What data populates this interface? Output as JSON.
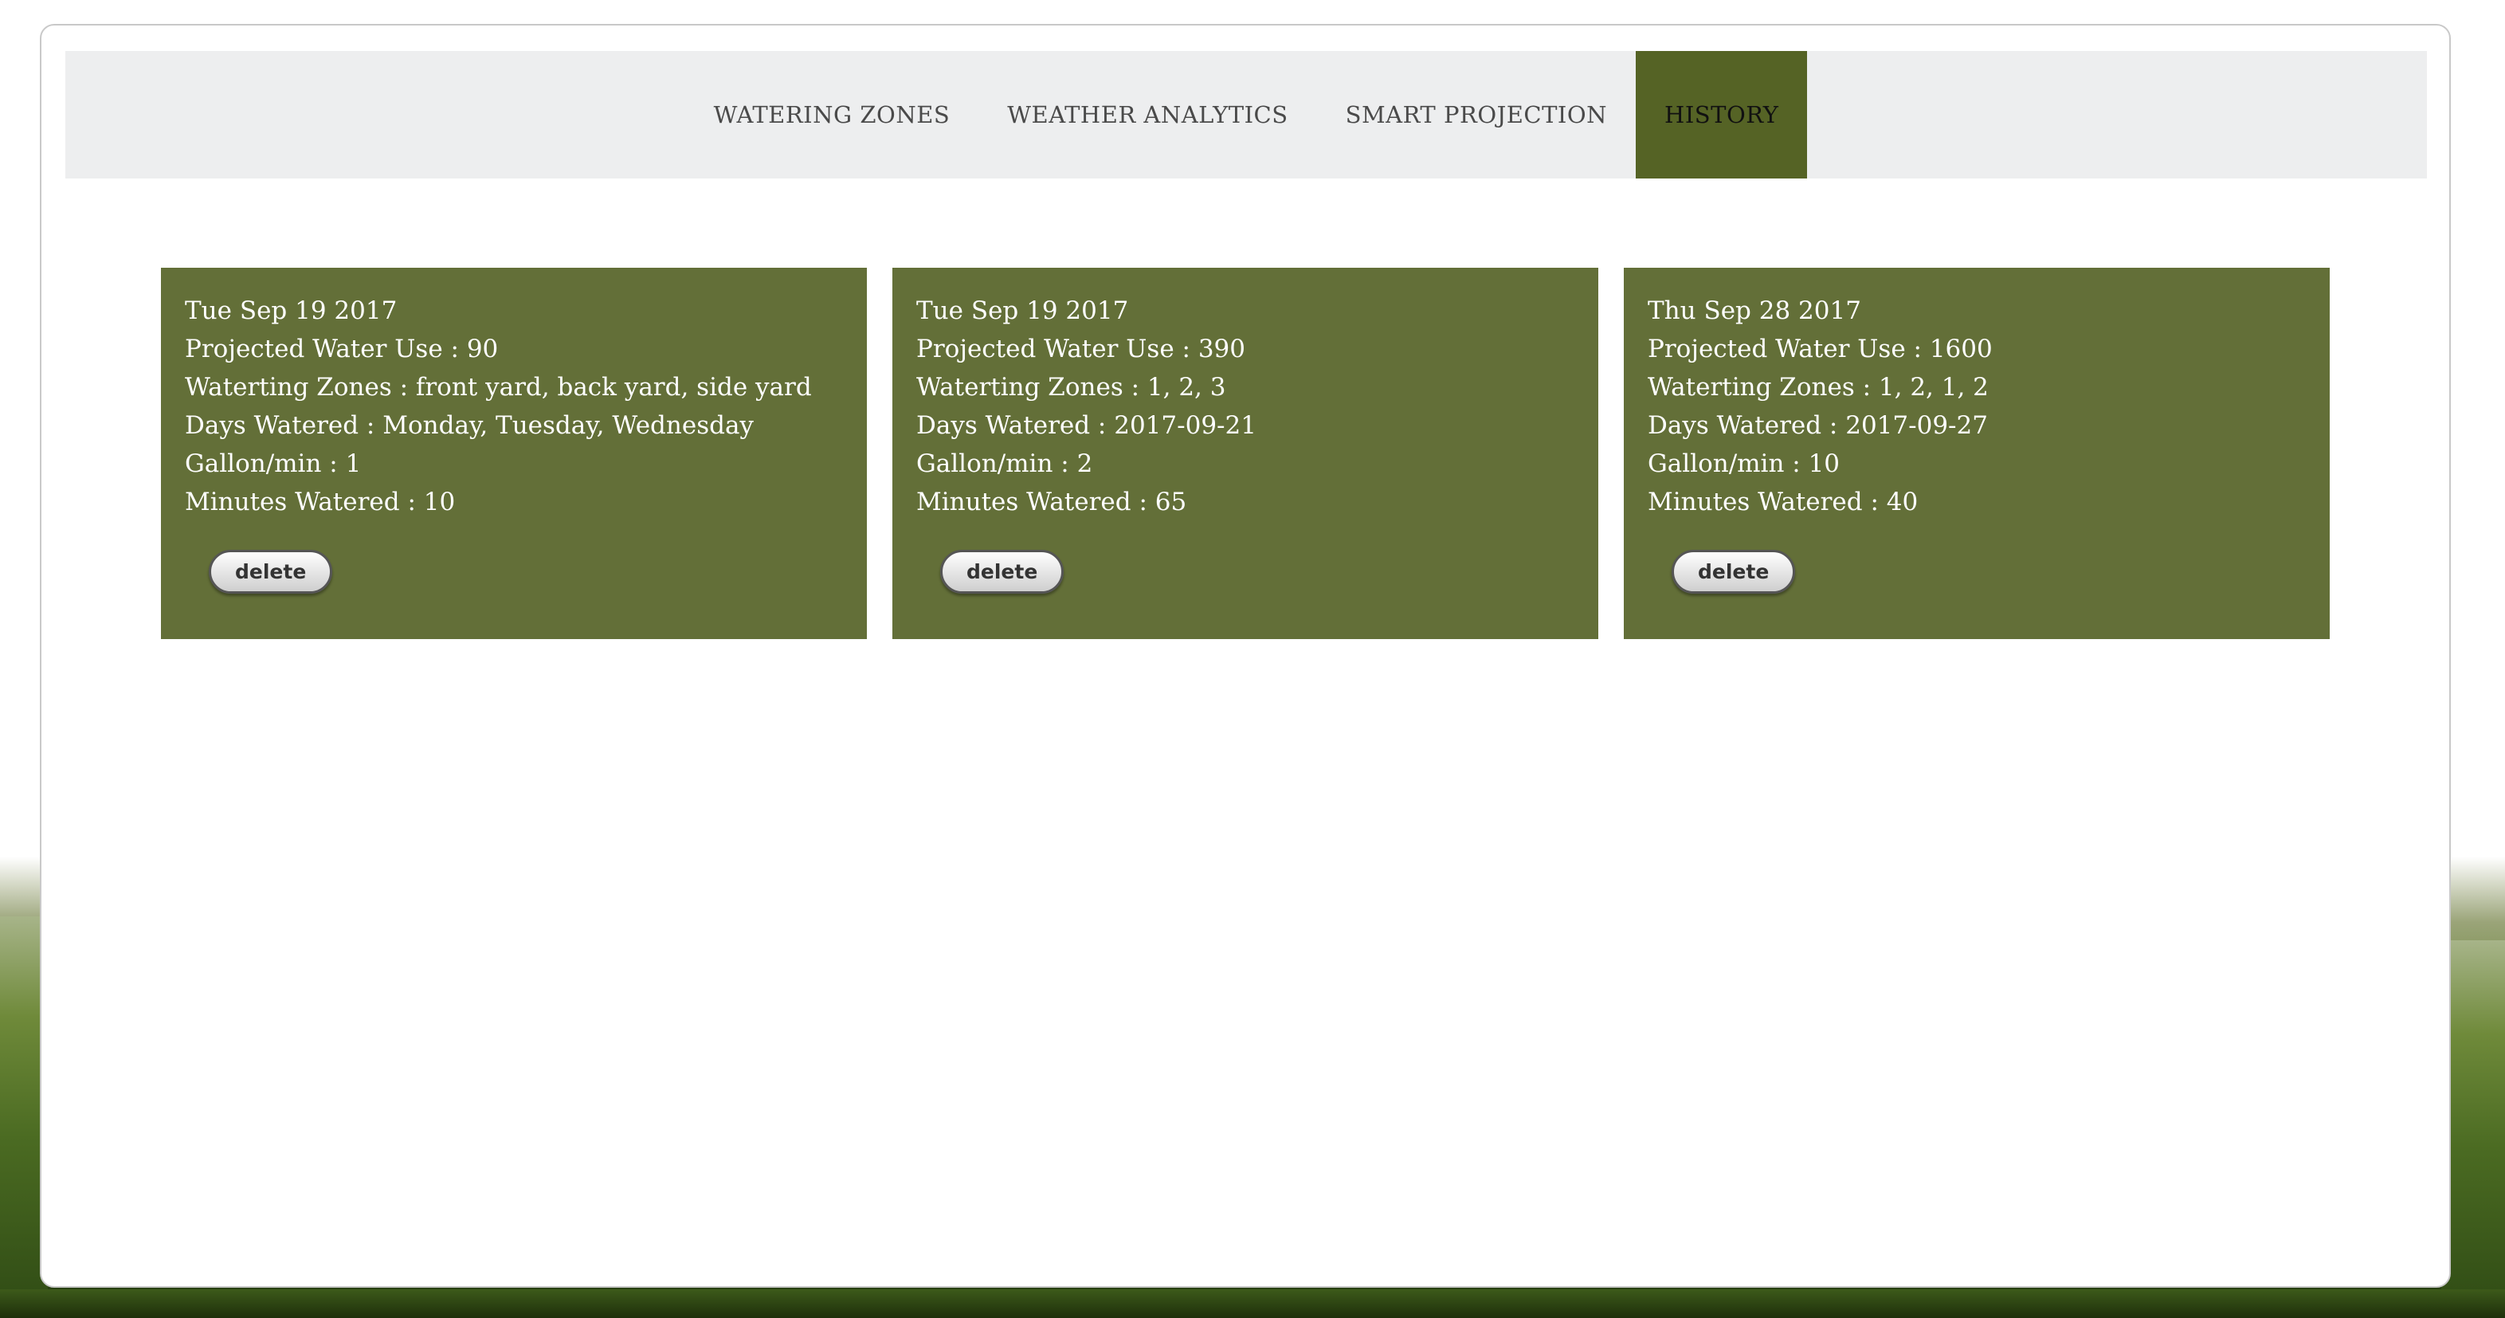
{
  "nav": {
    "tabs": [
      {
        "label": "WATERING ZONES"
      },
      {
        "label": "WEATHER ANALYTICS"
      },
      {
        "label": "SMART PROJECTION"
      },
      {
        "label": "HISTORY",
        "active": true
      }
    ]
  },
  "cards": [
    {
      "date": "Tue Sep 19 2017",
      "projected_water_use": "Projected Water Use : 90",
      "watering_zones": "Waterting Zones : front yard, back yard, side yard",
      "days_watered": "Days Watered : Monday, Tuesday, Wednesday",
      "gallon_per_min": "Gallon/min : 1",
      "minutes_watered": "Minutes Watered : 10",
      "delete_label": "delete"
    },
    {
      "date": "Tue Sep 19 2017",
      "projected_water_use": "Projected Water Use : 390",
      "watering_zones": "Waterting Zones : 1, 2, 3",
      "days_watered": "Days Watered : 2017-09-21",
      "gallon_per_min": "Gallon/min : 2",
      "minutes_watered": "Minutes Watered : 65",
      "delete_label": "delete"
    },
    {
      "date": "Thu Sep 28 2017",
      "projected_water_use": "Projected Water Use : 1600",
      "watering_zones": "Waterting Zones : 1, 2, 1, 2",
      "days_watered": "Days Watered : 2017-09-27",
      "gallon_per_min": "Gallon/min : 10",
      "minutes_watered": "Minutes Watered : 40",
      "delete_label": "delete"
    }
  ],
  "colors": {
    "card_background": "#636f38",
    "active_tab": "#556325",
    "nav_background": "#edeeef"
  }
}
